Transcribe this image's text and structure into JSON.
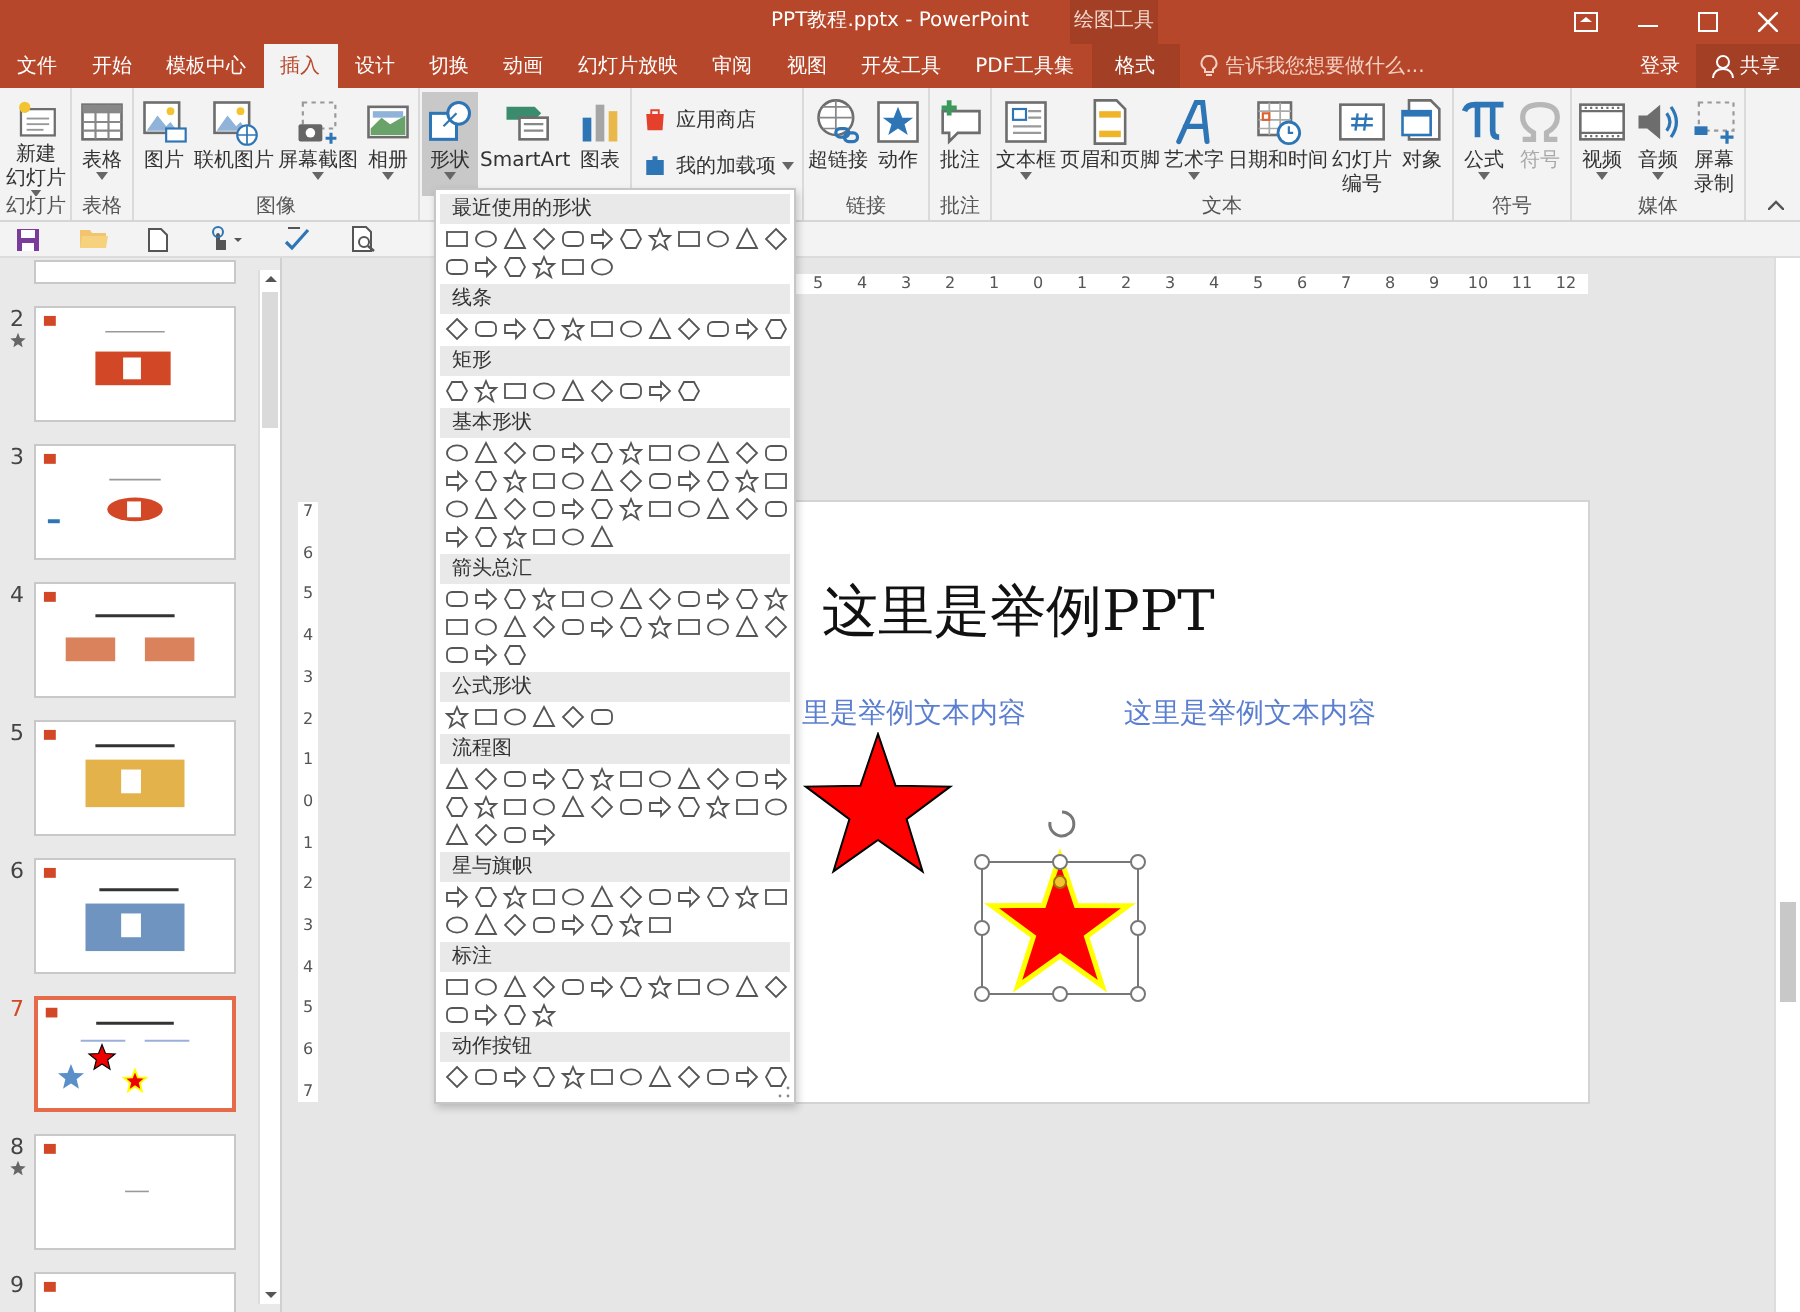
{
  "window": {
    "title": "PPT教程.pptx - PowerPoint",
    "context_label": "绘图工具"
  },
  "tabs": [
    {
      "label": "文件",
      "selected": false,
      "kind": "file"
    },
    {
      "label": "开始",
      "selected": false,
      "kind": "normal"
    },
    {
      "label": "模板中心",
      "selected": false,
      "kind": "normal"
    },
    {
      "label": "插入",
      "selected": true,
      "kind": "normal"
    },
    {
      "label": "设计",
      "selected": false,
      "kind": "normal"
    },
    {
      "label": "切换",
      "selected": false,
      "kind": "normal"
    },
    {
      "label": "动画",
      "selected": false,
      "kind": "normal"
    },
    {
      "label": "幻灯片放映",
      "selected": false,
      "kind": "normal"
    },
    {
      "label": "审阅",
      "selected": false,
      "kind": "normal"
    },
    {
      "label": "视图",
      "selected": false,
      "kind": "normal"
    },
    {
      "label": "开发工具",
      "selected": false,
      "kind": "normal"
    },
    {
      "label": "PDF工具集",
      "selected": false,
      "kind": "normal"
    },
    {
      "label": "格式",
      "selected": false,
      "kind": "context"
    }
  ],
  "tell_me": {
    "placeholder": "告诉我您想要做什么..."
  },
  "account": {
    "sign_in": "登录",
    "share": "共享"
  },
  "ribbon": {
    "groups": [
      {
        "kind": "large",
        "label": "幻灯片",
        "buttons": [
          {
            "lines": [
              "新建",
              "幻灯片"
            ],
            "dropdown": true,
            "pressed": false,
            "disabled": false
          }
        ]
      },
      {
        "kind": "large",
        "label": "表格",
        "buttons": [
          {
            "lines": [
              "表格"
            ],
            "dropdown": true,
            "pressed": false,
            "disabled": false
          }
        ]
      },
      {
        "kind": "large",
        "label": "图像",
        "buttons": [
          {
            "lines": [
              "图片"
            ],
            "dropdown": false,
            "pressed": false,
            "disabled": false
          },
          {
            "lines": [
              "联机图片"
            ],
            "dropdown": false,
            "pressed": false,
            "disabled": false
          },
          {
            "lines": [
              "屏幕截图"
            ],
            "dropdown": true,
            "pressed": false,
            "disabled": false
          },
          {
            "lines": [
              "相册"
            ],
            "dropdown": true,
            "pressed": false,
            "disabled": false
          }
        ]
      },
      {
        "kind": "large",
        "buttons": [
          {
            "lines": [
              "形状"
            ],
            "dropdown": true,
            "pressed": true,
            "disabled": false
          },
          {
            "lines": [
              "SmartArt"
            ],
            "dropdown": false,
            "pressed": false,
            "disabled": false
          },
          {
            "lines": [
              "图表"
            ],
            "dropdown": false,
            "pressed": false,
            "disabled": false
          }
        ]
      },
      {
        "kind": "small",
        "buttons": [
          {
            "lines": [
              "应用商店"
            ],
            "dropdown": false,
            "pressed": false,
            "disabled": false
          },
          {
            "lines": [
              "我的加载项"
            ],
            "dropdown": true,
            "pressed": false,
            "disabled": false
          }
        ]
      },
      {
        "kind": "large",
        "label": "链接",
        "buttons": [
          {
            "lines": [
              "超链接"
            ],
            "dropdown": false,
            "pressed": false,
            "disabled": false
          },
          {
            "lines": [
              "动作"
            ],
            "dropdown": false,
            "pressed": false,
            "disabled": false
          }
        ]
      },
      {
        "kind": "large",
        "label": "批注",
        "buttons": [
          {
            "lines": [
              "批注"
            ],
            "dropdown": false,
            "pressed": false,
            "disabled": false
          }
        ]
      },
      {
        "kind": "large",
        "label": "文本",
        "buttons": [
          {
            "lines": [
              "文本框"
            ],
            "dropdown": true,
            "pressed": false,
            "disabled": false
          },
          {
            "lines": [
              "页眉和页脚"
            ],
            "dropdown": false,
            "pressed": false,
            "disabled": false
          },
          {
            "lines": [
              "艺术字"
            ],
            "dropdown": true,
            "pressed": false,
            "disabled": false
          },
          {
            "lines": [
              "日期和时间"
            ],
            "dropdown": false,
            "pressed": false,
            "disabled": false
          },
          {
            "lines": [
              "幻灯片",
              "编号"
            ],
            "dropdown": false,
            "pressed": false,
            "disabled": false
          },
          {
            "lines": [
              "对象"
            ],
            "dropdown": false,
            "pressed": false,
            "disabled": false
          }
        ]
      },
      {
        "kind": "large",
        "label": "符号",
        "buttons": [
          {
            "lines": [
              "公式"
            ],
            "dropdown": true,
            "pressed": false,
            "disabled": false
          },
          {
            "lines": [
              "符号"
            ],
            "dropdown": false,
            "pressed": false,
            "disabled": true
          }
        ]
      },
      {
        "kind": "large",
        "label": "媒体",
        "buttons": [
          {
            "lines": [
              "视频"
            ],
            "dropdown": true,
            "pressed": false,
            "disabled": false
          },
          {
            "lines": [
              "音频"
            ],
            "dropdown": true,
            "pressed": false,
            "disabled": false
          },
          {
            "lines": [
              "屏幕",
              "录制"
            ],
            "dropdown": false,
            "pressed": false,
            "disabled": false
          }
        ]
      }
    ]
  },
  "slides": [
    {
      "kind": "partial-top",
      "selected": false,
      "animated": false
    },
    {
      "number": "2",
      "kind": "red-banner",
      "selected": false,
      "animated": true
    },
    {
      "number": "3",
      "kind": "red-oval",
      "selected": false,
      "animated": false
    },
    {
      "number": "4",
      "kind": "two-tiles",
      "selected": false,
      "animated": false
    },
    {
      "number": "5",
      "kind": "yellow-tile",
      "selected": false,
      "animated": false
    },
    {
      "number": "6",
      "kind": "blue-tile",
      "selected": false,
      "animated": false
    },
    {
      "number": "7",
      "kind": "stars",
      "selected": true,
      "animated": false
    },
    {
      "number": "8",
      "kind": "blank",
      "selected": false,
      "animated": true
    },
    {
      "number": "9",
      "kind": "partial-bottom",
      "selected": false,
      "animated": false
    }
  ],
  "ruler": {
    "horizontal": [
      "5",
      "4",
      "3",
      "2",
      "1",
      "0",
      "1",
      "2",
      "3",
      "4",
      "5",
      "6",
      "7",
      "8",
      "9",
      "10",
      "11",
      "12"
    ],
    "vertical": [
      "7",
      "6",
      "5",
      "4",
      "3",
      "2",
      "1",
      "0",
      "1",
      "2",
      "3",
      "4",
      "5",
      "6",
      "7"
    ]
  },
  "slide": {
    "title": "这里是举例PPT",
    "texts": [
      "里是举例文本内容",
      "这里是举例文本内容"
    ]
  },
  "shapes_menu": {
    "sections": [
      {
        "label": "最近使用的形状"
      },
      {
        "label": "线条"
      },
      {
        "label": "矩形"
      },
      {
        "label": "基本形状"
      },
      {
        "label": "箭头总汇"
      },
      {
        "label": "公式形状"
      },
      {
        "label": "流程图"
      },
      {
        "label": "星与旗帜"
      },
      {
        "label": "标注"
      },
      {
        "label": "动作按钮"
      }
    ]
  }
}
